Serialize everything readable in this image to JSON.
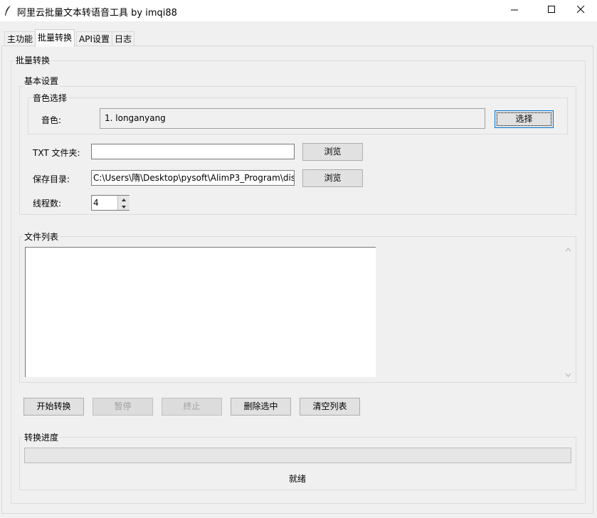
{
  "window": {
    "title": "阿里云批量文本转语音工具 by imqi88",
    "icons": {
      "app": "feather-icon",
      "minimize": "minimize-icon",
      "maximize": "maximize-icon",
      "close": "close-icon"
    }
  },
  "tabs": [
    {
      "label": "主功能"
    },
    {
      "label": "批量转换",
      "active": true
    },
    {
      "label": "API设置"
    },
    {
      "label": "日志"
    }
  ],
  "batch": {
    "frame_title": "批量转换",
    "basic": {
      "title": "基本设置",
      "voice": {
        "title": "音色选择",
        "label": "音色:",
        "value": "1. longanyang",
        "select_button": "选择"
      },
      "txt_folder": {
        "label": "TXT 文件夹:",
        "value": "",
        "browse_button": "浏览"
      },
      "save_dir": {
        "label": "保存目录:",
        "value": "C:\\Users\\隋\\Desktop\\pysoft\\AlimP3_Program\\dis",
        "browse_button": "浏览"
      },
      "threads": {
        "label": "线程数:",
        "value": "4"
      }
    },
    "file_list": {
      "title": "文件列表",
      "items": []
    },
    "buttons": {
      "start": "开始转换",
      "pause": "暂停",
      "stop": "终止",
      "delete_selected": "删除选中",
      "clear_list": "清空列表"
    },
    "progress": {
      "title": "转换进度",
      "value": 0,
      "status": "就绪"
    }
  },
  "colors": {
    "window_bg": "#f0f0f0",
    "titlebar_bg": "#ffffff",
    "accent": "#0078d7"
  }
}
